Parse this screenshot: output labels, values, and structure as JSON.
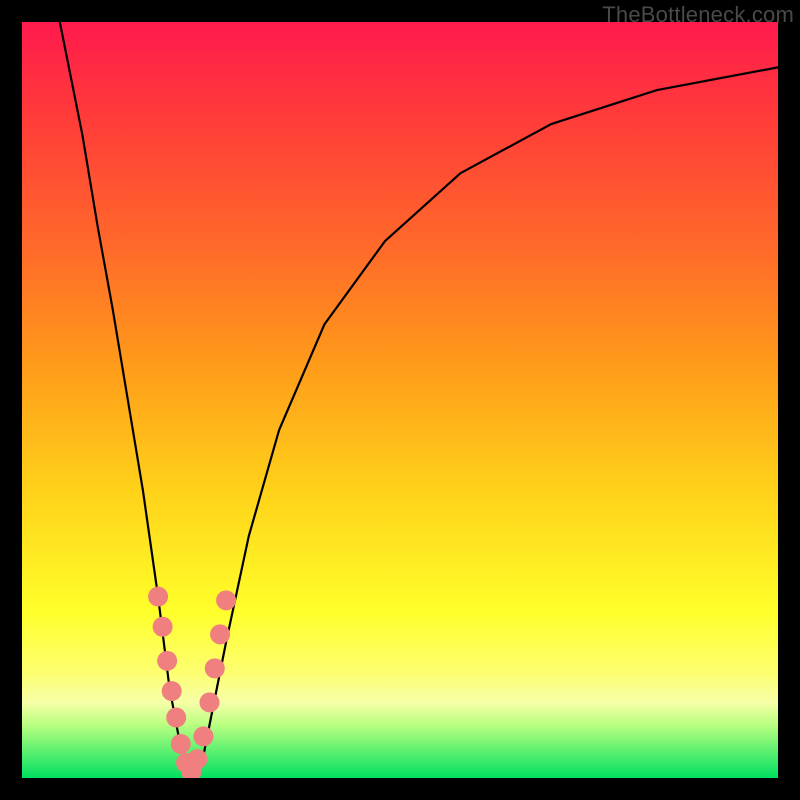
{
  "watermark": "TheBottleneck.com",
  "chart_data": {
    "type": "line",
    "title": "",
    "xlabel": "",
    "ylabel": "",
    "xlim": [
      0,
      100
    ],
    "ylim": [
      0,
      100
    ],
    "series": [
      {
        "name": "bottleneck-curve",
        "x": [
          5,
          8,
          10,
          12,
          14,
          16,
          18,
          19.5,
          21,
          22,
          23,
          24,
          25,
          27,
          30,
          34,
          40,
          48,
          58,
          70,
          84,
          100
        ],
        "y": [
          100,
          85,
          73,
          62,
          50,
          38,
          24,
          12,
          4,
          0.5,
          0.5,
          3,
          8,
          18,
          32,
          46,
          60,
          71,
          80,
          86.5,
          91,
          94
        ]
      }
    ],
    "markers": [
      {
        "name": "scatter-cluster",
        "color": "#f08080",
        "points": [
          {
            "x": 18.0,
            "y": 24.0
          },
          {
            "x": 18.6,
            "y": 20.0
          },
          {
            "x": 19.2,
            "y": 15.5
          },
          {
            "x": 19.8,
            "y": 11.5
          },
          {
            "x": 20.4,
            "y": 8.0
          },
          {
            "x": 21.0,
            "y": 4.5
          },
          {
            "x": 21.7,
            "y": 2.0
          },
          {
            "x": 22.4,
            "y": 0.8
          },
          {
            "x": 23.2,
            "y": 2.5
          },
          {
            "x": 24.0,
            "y": 5.5
          },
          {
            "x": 24.8,
            "y": 10.0
          },
          {
            "x": 25.5,
            "y": 14.5
          },
          {
            "x": 26.2,
            "y": 19.0
          },
          {
            "x": 27.0,
            "y": 23.5
          }
        ]
      }
    ],
    "gradient": {
      "stops": [
        {
          "pos": 0,
          "color": "#ff1a4d"
        },
        {
          "pos": 12,
          "color": "#ff3a3a"
        },
        {
          "pos": 30,
          "color": "#ff6a2a"
        },
        {
          "pos": 45,
          "color": "#ff9a1a"
        },
        {
          "pos": 62,
          "color": "#ffd21a"
        },
        {
          "pos": 78,
          "color": "#ffff2a"
        },
        {
          "pos": 86,
          "color": "#fdff70"
        },
        {
          "pos": 90,
          "color": "#f6ffa8"
        },
        {
          "pos": 93,
          "color": "#b8ff80"
        },
        {
          "pos": 100,
          "color": "#00e060"
        }
      ]
    }
  }
}
